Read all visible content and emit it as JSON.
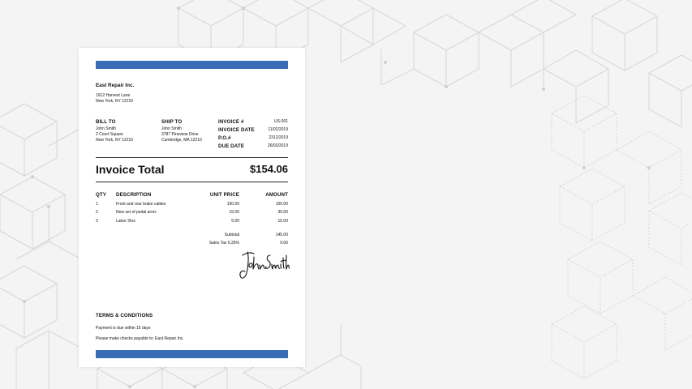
{
  "colors": {
    "accent": "#3a6db5",
    "background": "#f4f4f4",
    "paper": "#ffffff"
  },
  "company": {
    "name": "East Repair Inc.",
    "address_line1": "1912 Harvest Lane",
    "address_line2": "New York, NY 12210"
  },
  "bill_to": {
    "title": "BILL TO",
    "name": "John Smith",
    "line1": "2 Court Square",
    "line2": "New York, NY 12210"
  },
  "ship_to": {
    "title": "SHIP TO",
    "name": "John Smith",
    "line1": "3787 Pineview Drive",
    "line2": "Cambridge, MA 12210"
  },
  "invoice_meta": [
    {
      "label": "INVOICE #",
      "value": "US-001"
    },
    {
      "label": "INVOICE DATE",
      "value": "11/02/2019"
    },
    {
      "label": "P.O.#",
      "value": "2312/2019"
    },
    {
      "label": "DUE DATE",
      "value": "26/02/2019"
    }
  ],
  "total": {
    "label": "Invoice Total",
    "value": "$154.06"
  },
  "table": {
    "headers": {
      "qty": "QTY",
      "description": "DESCRIPTION",
      "unit_price": "UNIT PRICE",
      "amount": "AMOUNT"
    },
    "rows": [
      {
        "qty": "1",
        "description": "Front and rear brake cables",
        "unit_price": "100.00",
        "amount": "100.00"
      },
      {
        "qty": "2",
        "description": "New set of pedal arms",
        "unit_price": "15.00",
        "amount": "30.00"
      },
      {
        "qty": "3",
        "description": "Labor 3hrs",
        "unit_price": "5.00",
        "amount": "15.00"
      }
    ]
  },
  "summary": {
    "subtotal_label": "Subtotal",
    "subtotal_value": "145.00",
    "tax_label": "Sales Tax 6.25%",
    "tax_value": "9.06"
  },
  "signature": {
    "text": "John Smith"
  },
  "terms": {
    "title": "TERMS & CONDITIONS",
    "line1": "Payment is due within 15 days",
    "line2": "Please make checks payable to: East Repair Inc."
  }
}
